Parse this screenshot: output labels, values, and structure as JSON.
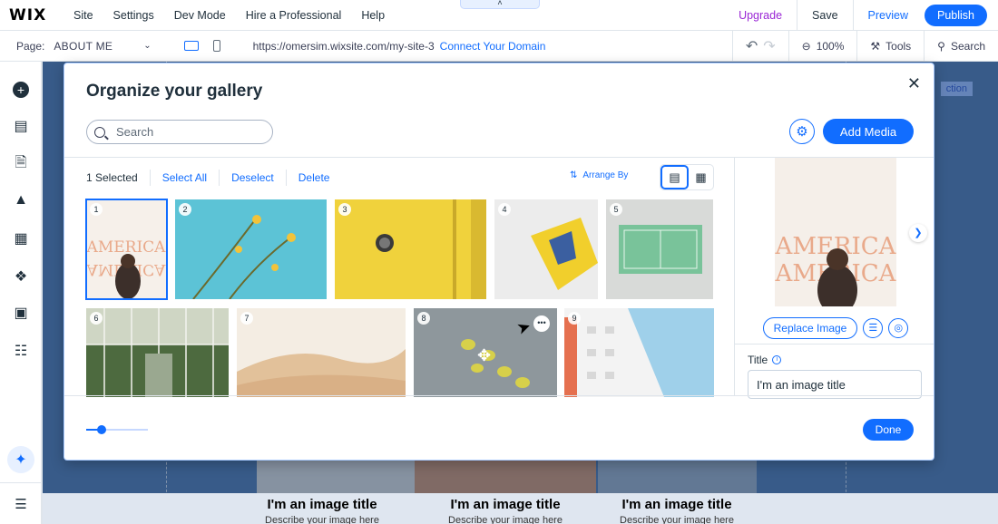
{
  "topbar": {
    "logo": "WIX",
    "menu": [
      "Site",
      "Settings",
      "Dev Mode",
      "Hire a Professional",
      "Help"
    ],
    "upgrade": "Upgrade",
    "save": "Save",
    "preview": "Preview",
    "publish": "Publish",
    "collapse_glyph": "˄"
  },
  "bar2": {
    "page_label": "Page:",
    "page_name": "ABOUT ME",
    "url": "https://omersim.wixsite.com/my-site-3",
    "connect": "Connect Your Domain",
    "zoom": "100%",
    "tools": "Tools",
    "search": "Search"
  },
  "canvas": {
    "section_tag": "ction",
    "captions": [
      {
        "title": "I'm an image title",
        "desc": "Describe your image here"
      },
      {
        "title": "I'm an image title",
        "desc": "Describe your image here"
      },
      {
        "title": "I'm an image title",
        "desc": "Describe your image here"
      }
    ]
  },
  "modal": {
    "title": "Organize your gallery",
    "search_placeholder": "Search",
    "add_media": "Add Media",
    "selected": "1 Selected",
    "select_all": "Select All",
    "deselect": "Deselect",
    "delete": "Delete",
    "arrange_by": "Arrange By",
    "tiles": [
      "1",
      "2",
      "3",
      "4",
      "5",
      "6",
      "7",
      "8",
      "9"
    ],
    "replace_image": "Replace Image",
    "title_label": "Title",
    "title_value": "I'm an image title",
    "done": "Done",
    "thumb_size": 0.25,
    "preview_text_top": "AMERICA",
    "preview_text_bottom": "AMERICA"
  },
  "colors": {
    "accent": "#116dff",
    "upgrade": "#9a27d5"
  }
}
